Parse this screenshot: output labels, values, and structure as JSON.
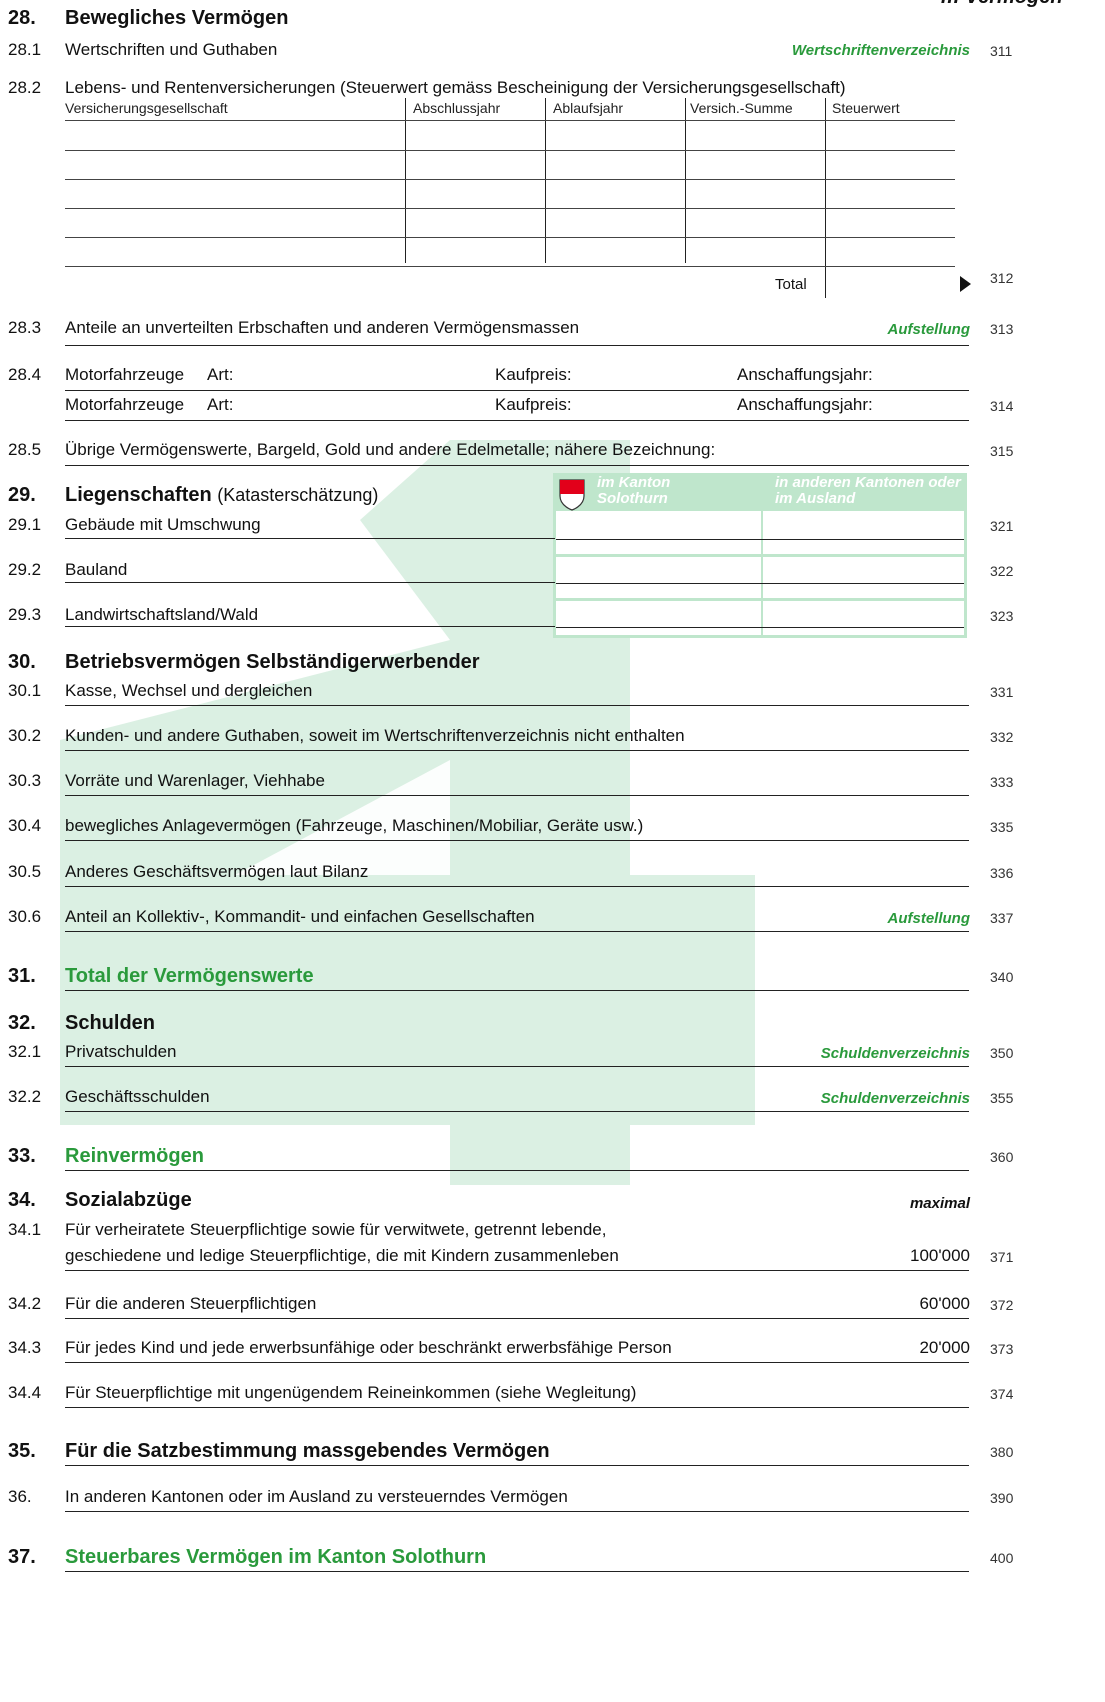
{
  "header_fragment": "… Vermögen",
  "s28": {
    "num": "28.",
    "title": "Bewegliches Vermögen",
    "i1": {
      "num": "28.1",
      "label": "Wertschriften und Guthaben",
      "ref": "Wertschriftenverzeichnis",
      "code": "311"
    },
    "i2": {
      "num": "28.2",
      "label": "Lebens- und Rentenversicherungen (Steuerwert gemäss Bescheinigung der Versicherungsgesellschaft)",
      "columns": [
        "Versicherungsgesellschaft",
        "Abschlussjahr",
        "Ablaufsjahr",
        "Versich.-Summe",
        "Steuerwert"
      ],
      "total_label": "Total",
      "code": "312"
    },
    "i3": {
      "num": "28.3",
      "label": "Anteile an unverteilten Erbschaften und anderen Vermögensmassen",
      "ref": "Aufstellung",
      "code": "313"
    },
    "i4": {
      "num": "28.4",
      "label": "Motorfahrzeuge",
      "art": "Art:",
      "kaufpreis": "Kaufpreis:",
      "jahr": "Anschaffungsjahr:",
      "code": "314"
    },
    "i5": {
      "num": "28.5",
      "label": "Übrige Vermögenswerte, Bargeld, Gold und andere Edelmetalle; nähere Bezeichnung:",
      "code": "315"
    }
  },
  "s29": {
    "num": "29.",
    "title": "Liegenschaften",
    "subtitle": "(Katasterschätzung)",
    "col1": "im Kanton Solothurn",
    "col2": "in anderen Kantonen oder im Ausland",
    "items": [
      {
        "num": "29.1",
        "label": "Gebäude mit Umschwung",
        "code": "321"
      },
      {
        "num": "29.2",
        "label": "Bauland",
        "code": "322"
      },
      {
        "num": "29.3",
        "label": "Landwirtschaftsland/Wald",
        "code": "323"
      }
    ]
  },
  "s30": {
    "num": "30.",
    "title": "Betriebsvermögen Selbständigerwerbender",
    "items": [
      {
        "num": "30.1",
        "label": "Kasse, Wechsel und dergleichen",
        "code": "331"
      },
      {
        "num": "30.2",
        "label": "Kunden- und andere Guthaben, soweit im Wertschriftenverzeichnis nicht enthalten",
        "code": "332"
      },
      {
        "num": "30.3",
        "label": "Vorräte und Warenlager, Viehhabe",
        "code": "333"
      },
      {
        "num": "30.4",
        "label": "bewegliches Anlagevermögen (Fahrzeuge, Maschinen/Mobiliar, Geräte usw.)",
        "code": "335"
      },
      {
        "num": "30.5",
        "label": "Anderes Geschäftsvermögen laut Bilanz",
        "code": "336"
      },
      {
        "num": "30.6",
        "label": "Anteil an Kollektiv-, Kommandit- und einfachen Gesellschaften",
        "ref": "Aufstellung",
        "code": "337"
      }
    ]
  },
  "s31": {
    "num": "31.",
    "title": "Total der Vermögenswerte",
    "code": "340"
  },
  "s32": {
    "num": "32.",
    "title": "Schulden",
    "items": [
      {
        "num": "32.1",
        "label": "Privatschulden",
        "ref": "Schuldenverzeichnis",
        "code": "350"
      },
      {
        "num": "32.2",
        "label": "Geschäftsschulden",
        "ref": "Schuldenverzeichnis",
        "code": "355"
      }
    ]
  },
  "s33": {
    "num": "33.",
    "title": "Reinvermögen",
    "code": "360"
  },
  "s34": {
    "num": "34.",
    "title": "Sozialabzüge",
    "max_label": "maximal",
    "i1": {
      "num": "34.1",
      "line1": "Für verheiratete Steuerpflichtige sowie für verwitwete, getrennt lebende,",
      "line2": "geschiedene und ledige Steuerpflichtige, die mit Kindern zusammenleben",
      "max": "100'000",
      "code": "371"
    },
    "i2": {
      "num": "34.2",
      "label": "Für die anderen Steuerpflichtigen",
      "max": "60'000",
      "code": "372"
    },
    "i3": {
      "num": "34.3",
      "label": "Für jedes Kind und jede erwerbsunfähige oder beschränkt erwerbsfähige Person",
      "max": "20'000",
      "code": "373"
    },
    "i4": {
      "num": "34.4",
      "label": "Für Steuerpflichtige mit ungenügendem Reineinkommen (siehe Wegleitung)",
      "code": "374"
    }
  },
  "s35": {
    "num": "35.",
    "title": "Für die Satzbestimmung massgebendes Vermögen",
    "code": "380"
  },
  "s36": {
    "num": "36.",
    "label": "In anderen Kantonen oder im Ausland zu versteuerndes Vermögen",
    "code": "390"
  },
  "s37": {
    "num": "37.",
    "title": "Steuerbares Vermögen im Kanton Solothurn",
    "code": "400"
  },
  "colors": {
    "accent_green": "#2a9a3c",
    "watermark": "#cfeadb"
  }
}
